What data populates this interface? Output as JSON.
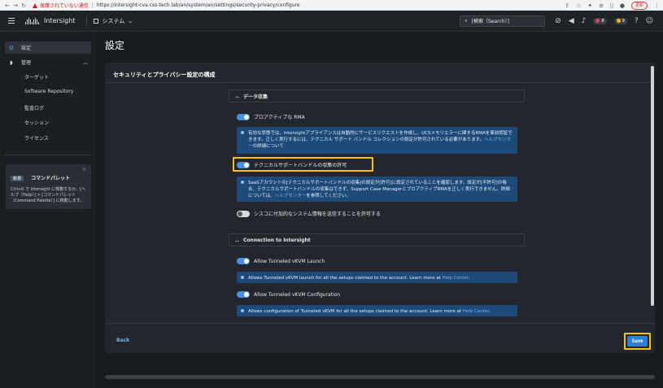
{
  "browser": {
    "warning": "保護されていない通信",
    "url": "https://intersight-cva.css-tech.lab/an/system/an/settings/security-privacy/configure",
    "update_label": "更新"
  },
  "header": {
    "brand": "Intersight",
    "system_label": "システム",
    "search_placeholder": "[検索（Search）]",
    "alert_count_red": "8",
    "alert_count_yellow": "9"
  },
  "sidebar": {
    "settings_label": "設定",
    "admin_label": "管理",
    "sub_items": [
      "ターゲット",
      "Software Repository",
      "監査ログ",
      "セッション",
      "ライセンス"
    ],
    "palette": {
      "tag": "新規",
      "title": "コマンドパレット",
      "body": "Ctrl+K で Intersight に移動するか、[ヘルプ（Help）] > [コマンドパレット（Command Palette）] に移動します。"
    }
  },
  "main": {
    "page_title": "設定",
    "panel_title": "セキュリティとプライバシー設定の構成",
    "data_collection": {
      "heading": "データ収集",
      "proactive_rma": {
        "label": "プロアクティブな RMA",
        "info": "有効な状態では、Intersightアプライアンスは自動的にサービスリクエストを作成し、UCSメモリエラーに関するRMAを事前認証できます。正しく実行するには、テクニカル サポート バンドル コレクションの設定が許可されている必要があります。",
        "info_link": "ヘルプセンター",
        "info_tail": "の詳細について"
      },
      "tech_support": {
        "label": "テクニカルサポートバンドルの収集の許可",
        "info": "SaaSアカウントの[テクニカルサポートバンドルの収集]の設定が[許可]に設定されていることを確認します。設定が[不許可]の場合、テクニカルサポートバンドルの収集はできず、Support Case ManagerとプロアクティブRMAを正しく実行できません。詳細については、",
        "info_link": "ヘルプセンター",
        "info_tail": "を参照してください。"
      },
      "system_info": {
        "label": "シスコに付加的なシステム情報を送信することを許可する"
      }
    },
    "connection": {
      "heading": "Connection to Intersight",
      "vkvm_launch": {
        "label": "Allow Tunneled vKVM Launch",
        "info": "Allows Tunneled vKVM launch for all the setups claimed to the account. Learn more at ",
        "info_link": "Help Center",
        "info_tail": "."
      },
      "vkvm_config": {
        "label": "Allow Tunneled vKVM Configuration",
        "info": "Allows configuration of Tunneled vKVM for all the setups claimed to the account. Learn more at ",
        "info_link": "Help Center",
        "info_tail": "."
      }
    },
    "back_label": "Back",
    "save_label": "Save"
  }
}
